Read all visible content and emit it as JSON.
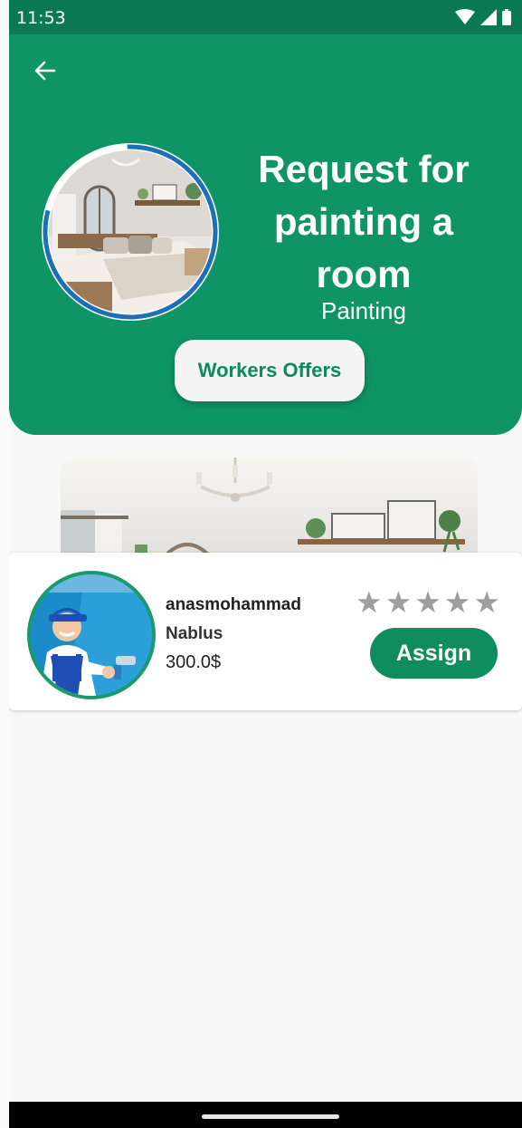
{
  "status_bar": {
    "time": "11:53",
    "icons": [
      "wifi-icon",
      "signal-icon",
      "battery-icon"
    ]
  },
  "header": {
    "back_icon": "arrow-left-icon",
    "title": "Request for painting a room",
    "category": "Painting",
    "offers_button_label": "Workers Offers"
  },
  "offer": {
    "worker_name": "anasmohammad",
    "city": "Nablus",
    "price": "300.0$",
    "rating": 0,
    "rating_max": 5,
    "assign_label": "Assign"
  },
  "colors": {
    "primary": "#0f9565",
    "status_bar": "#0b7a54",
    "button_text": "#0d8a5c",
    "assign_button": "#0f8d5e",
    "star_empty": "#9e9e9e",
    "progress_ring": "#1f6fb5"
  }
}
